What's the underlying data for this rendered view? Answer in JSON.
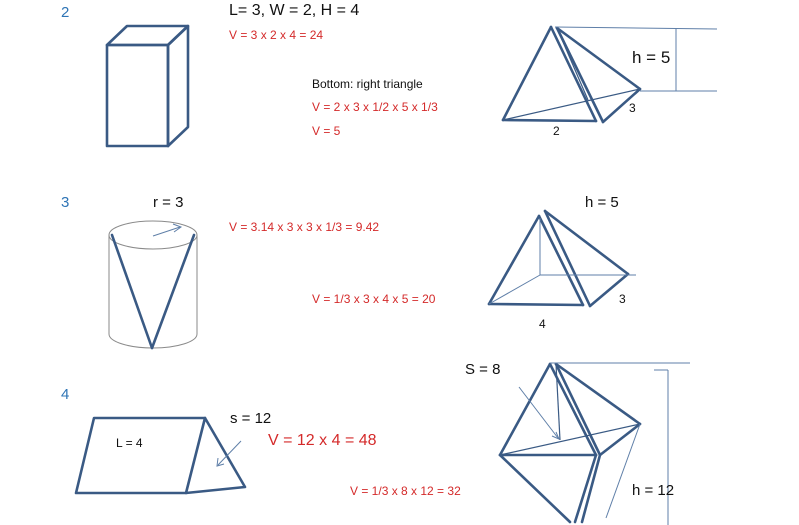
{
  "problems": [
    {
      "number": "2",
      "given": "L= 3, W = 2, H = 4",
      "calc1": "V = 3 x 2 x 4 = 24",
      "note": "Bottom: right triangle",
      "calc2": "V = 2 x 3 x 1/2 x 5 x 1/3",
      "calc3": "V = 5",
      "height_label": "h = 5",
      "side_a": "3",
      "side_b": "2"
    },
    {
      "number": "3",
      "radius_label": "r = 3",
      "calc1": "V = 3.14 x  3 x 3 x 1/3 = 9.42",
      "height_label": "h = 5",
      "calc2": "V = 1/3 x 3 x 4 x 5 = 20",
      "side_a": "3",
      "side_b": "4"
    },
    {
      "number": "4",
      "length_label": "L = 4",
      "side_label": "s = 12",
      "calc1": "V = 12 x 4 = 48",
      "slant_label": "S = 8",
      "calc2": "V = 1/3 x 8 x 12 = 32",
      "height_label": "h = 12"
    }
  ],
  "colors": {
    "figure_stroke": "#3a5a84",
    "number": "#2e74b5",
    "formula": "#d42a2a",
    "text": "#111111"
  }
}
